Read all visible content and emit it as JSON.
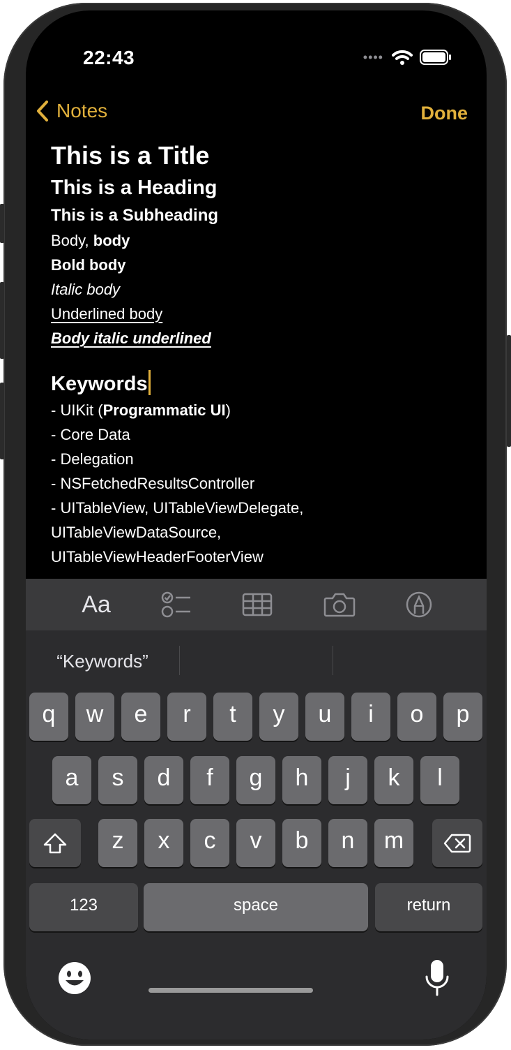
{
  "status": {
    "time": "22:43"
  },
  "nav": {
    "back_label": "Notes",
    "done_label": "Done"
  },
  "note": {
    "title": "This is a Title",
    "heading": "This is a Heading",
    "subheading": "This is a Subheading",
    "body_plain": "Body, ",
    "body_bold_inline": "body",
    "bold_body": "Bold body",
    "italic_body": "Italic body",
    "underlined_body": "Underlined body",
    "italic_underlined": "Body italic underlined",
    "keywords_heading": "Keywords",
    "list": {
      "item1_prefix": "- UIKit (",
      "item1_bold": "Programmatic UI",
      "item1_suffix": ")",
      "item2": "- Core Data",
      "item3": "- Delegation",
      "item4": "- NSFetchedResultsController",
      "item5_line1": "- UITableView, UITableViewDelegate,",
      "item5_line2": "UITableViewDataSource,",
      "item5_line3": "UITableViewHeaderFooterView"
    }
  },
  "toolbar": {
    "format_label": "Aa"
  },
  "suggestions": [
    "“Keywords”",
    "",
    ""
  ],
  "keyboard": {
    "row1": [
      "q",
      "w",
      "e",
      "r",
      "t",
      "y",
      "u",
      "i",
      "o",
      "p"
    ],
    "row2": [
      "a",
      "s",
      "d",
      "f",
      "g",
      "h",
      "j",
      "k",
      "l"
    ],
    "row3": [
      "z",
      "x",
      "c",
      "v",
      "b",
      "n",
      "m"
    ],
    "numbers_label": "123",
    "space_label": "space",
    "return_label": "return"
  },
  "colors": {
    "accent": "#e2b13c",
    "key": "#6b6b6e",
    "key_dark": "#48484a",
    "keyboard_bg": "#2c2c2e"
  }
}
